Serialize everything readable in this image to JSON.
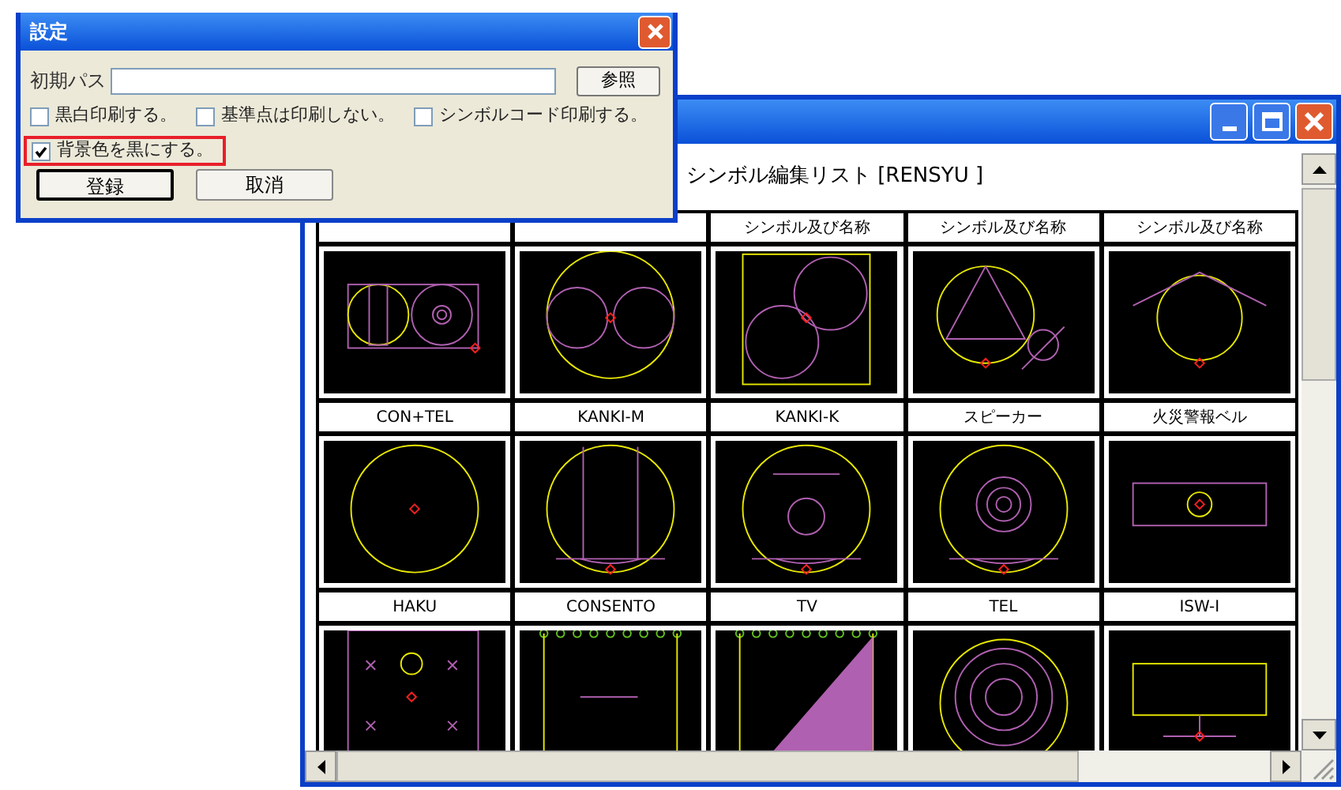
{
  "settings_dialog": {
    "title": "設定",
    "path_label": "初期パス",
    "browse_button": "参照",
    "checkbox_rows": [
      [
        {
          "label": "黒白印刷する。",
          "checked": false,
          "highlighted": false
        },
        {
          "label": "基準点は印刷しない。",
          "checked": false,
          "highlighted": false
        },
        {
          "label": "シンボルコード印刷する。",
          "checked": false,
          "highlighted": false
        }
      ],
      [
        {
          "label": "背景色を黒にする。",
          "checked": true,
          "highlighted": true
        }
      ]
    ],
    "buttons": [
      {
        "label": "登録",
        "default": true
      },
      {
        "label": "取消",
        "default": false
      }
    ]
  },
  "list_window": {
    "heading": "シンボル編集リスト [RENSYU ]",
    "rows": [
      [
        {
          "kind": "twin"
        },
        {
          "kind": "eight"
        },
        {
          "label": "シンボル及び名称",
          "kind": "pair"
        },
        {
          "label": "シンボル及び名称",
          "kind": "triangle"
        },
        {
          "label": "シンボル及び名称",
          "kind": "tangent"
        }
      ],
      [
        {
          "label": "CON+TEL",
          "kind": "dot"
        },
        {
          "label": "KANKI-M",
          "kind": "vbars"
        },
        {
          "label": "KANKI-K",
          "kind": "barring"
        },
        {
          "label": "スピーカー",
          "kind": "rings"
        },
        {
          "label": "火災警報ベル",
          "kind": "bell"
        }
      ],
      [
        {
          "label": "HAKU",
          "kind": "crosses"
        },
        {
          "label": "CONSENTO",
          "kind": "outlet"
        },
        {
          "label": "TV",
          "kind": "tv"
        },
        {
          "label": "TEL",
          "kind": "tel"
        },
        {
          "label": "ISW-I",
          "kind": "switch"
        }
      ]
    ]
  }
}
